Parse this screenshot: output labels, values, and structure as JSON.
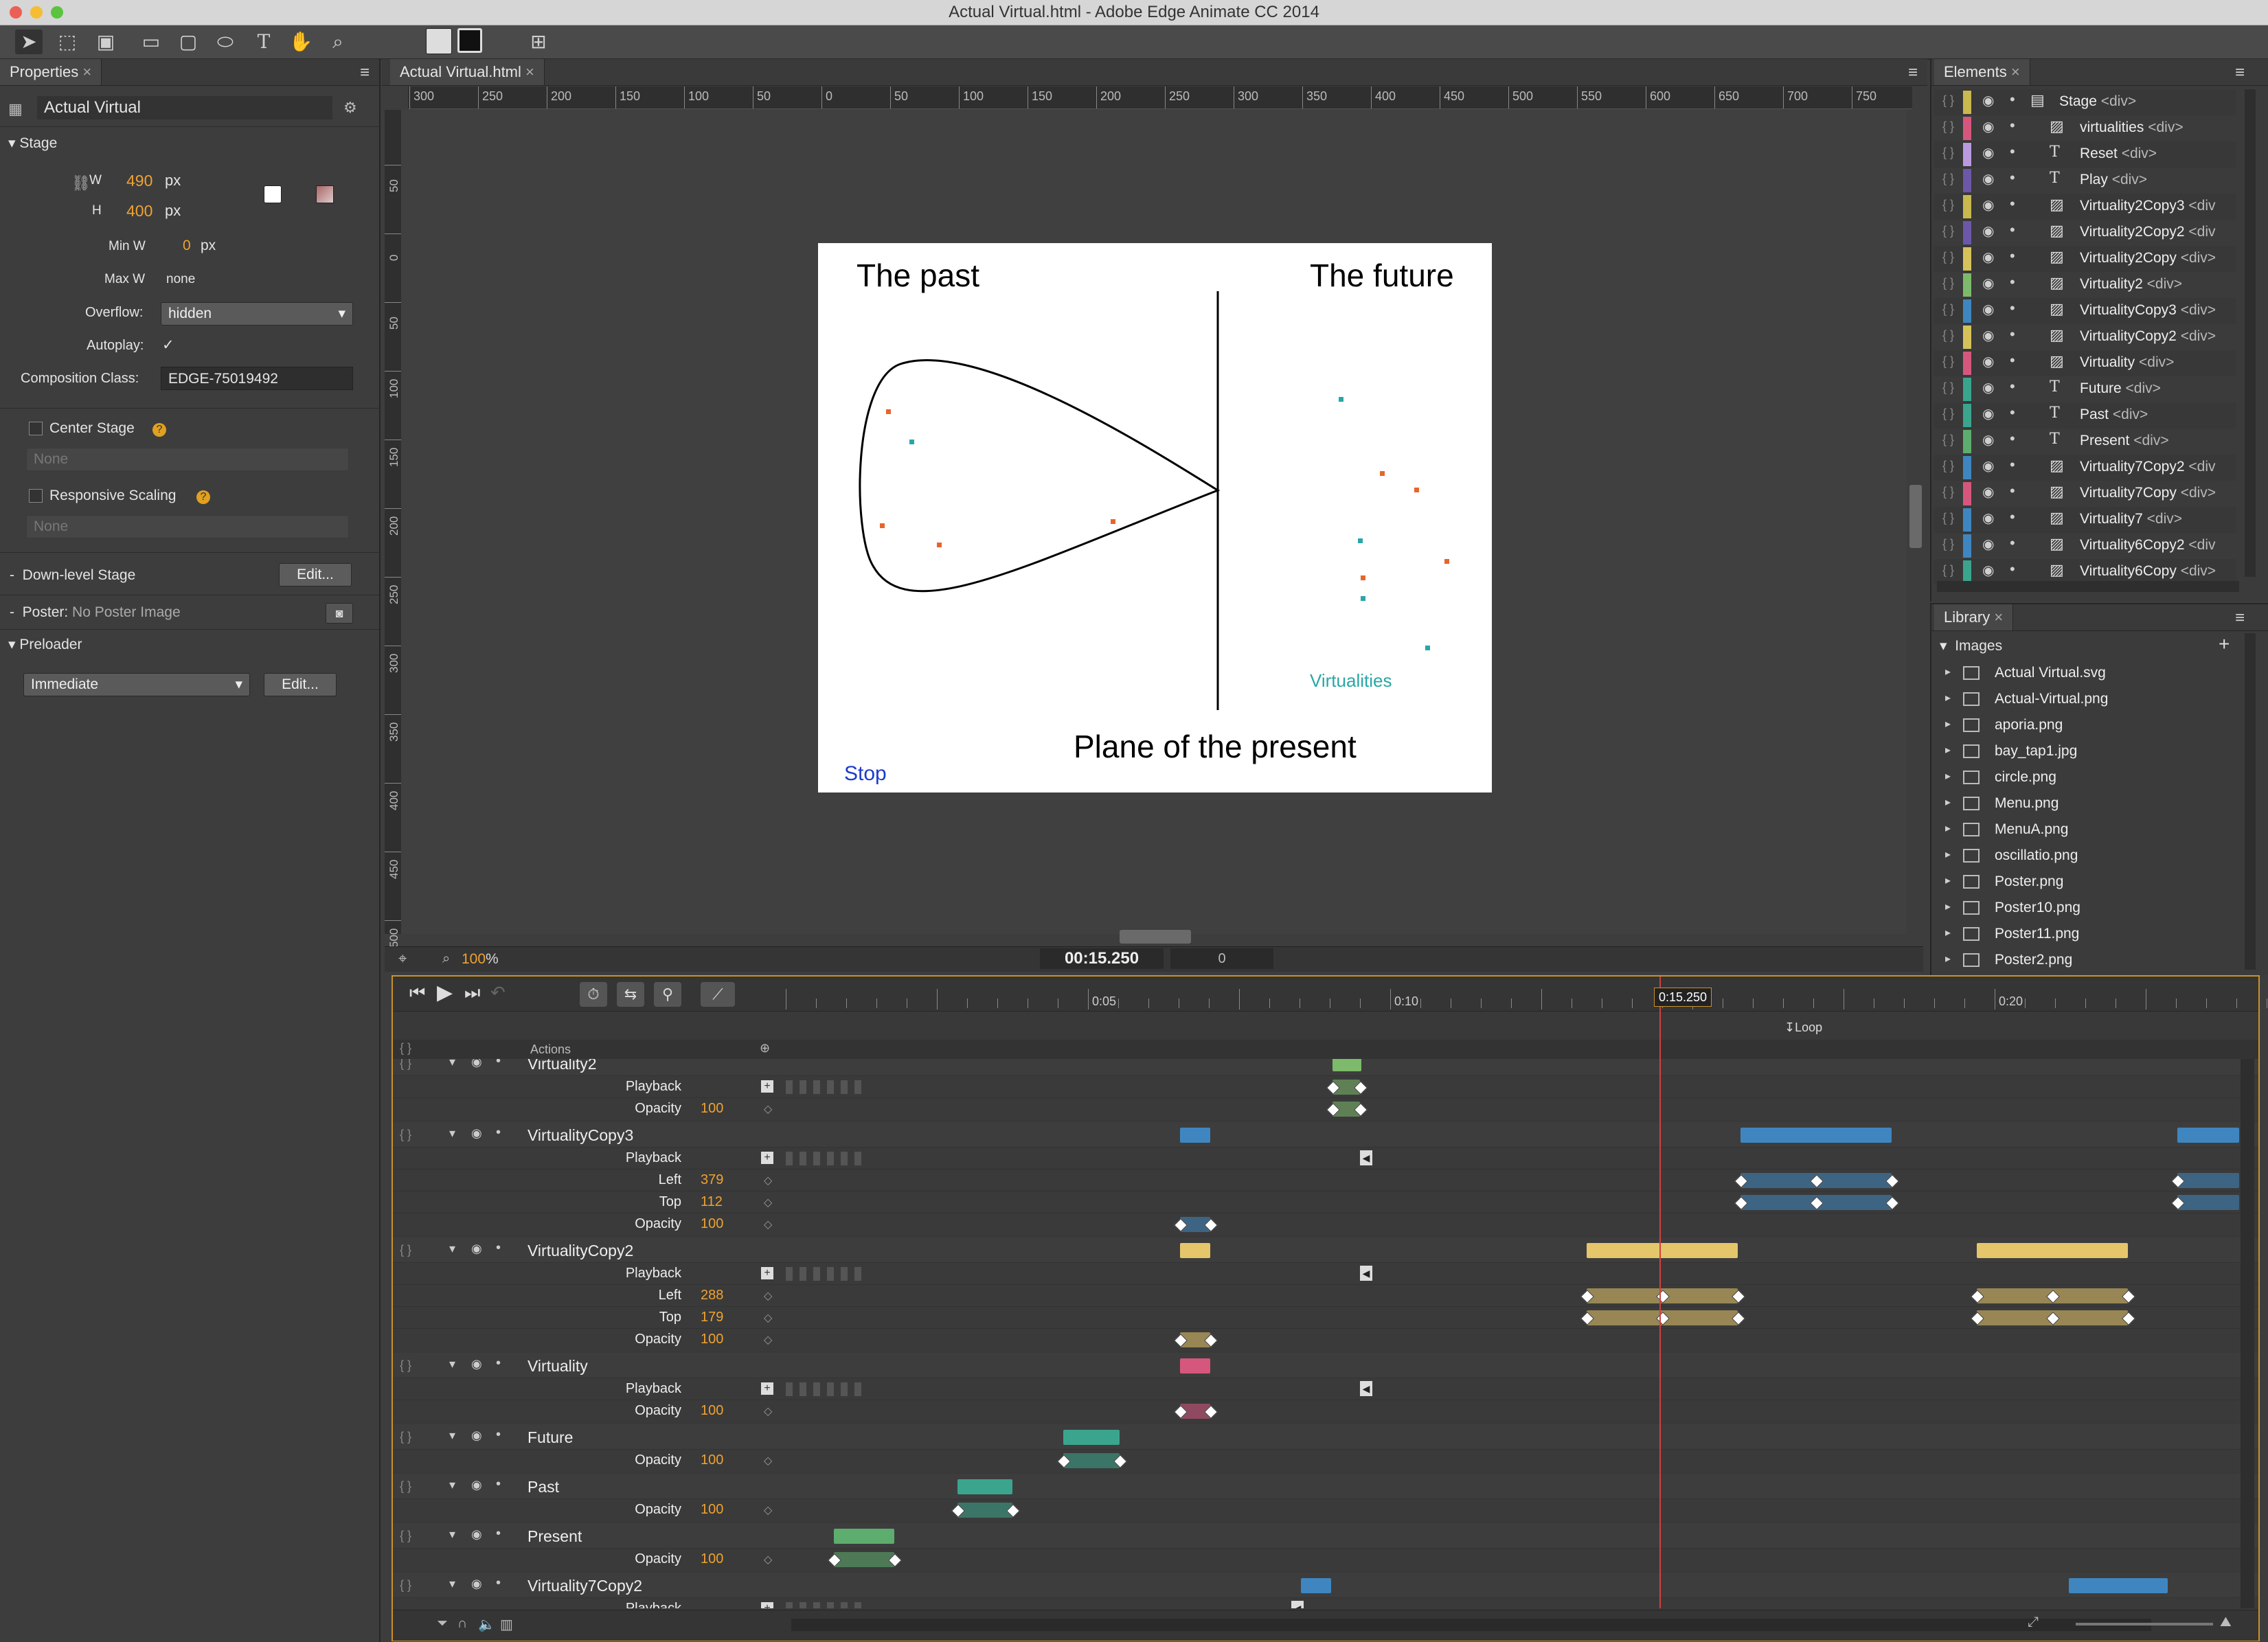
{
  "window": {
    "title": "Actual Virtual.html - Adobe Edge Animate CC 2014"
  },
  "properties": {
    "tab": "Properties",
    "element_name": "Actual Virtual",
    "stage_section": "Stage",
    "w_label": "W",
    "w_value": "490",
    "h_label": "H",
    "h_value": "400",
    "px": "px",
    "minw_label": "Min W",
    "minw_value": "0",
    "maxw_label": "Max W",
    "maxw_value": "none",
    "overflow_label": "Overflow:",
    "overflow_value": "hidden",
    "autoplay_label": "Autoplay:",
    "autoplay_check": "✓",
    "compclass_label": "Composition Class:",
    "compclass_value": "EDGE-75019492",
    "center_stage": "Center Stage",
    "center_none": "None",
    "responsive": "Responsive Scaling",
    "responsive_none": "None",
    "downlevel": "Down-level Stage",
    "edit": "Edit...",
    "poster_label": "Poster:",
    "poster_value": "No Poster Image",
    "preloader": "Preloader",
    "preloader_value": "Immediate"
  },
  "document": {
    "tab": "Actual Virtual.html",
    "ruler_h": [
      "300",
      "250",
      "200",
      "150",
      "100",
      "50",
      "0",
      "50",
      "100",
      "150",
      "200",
      "250",
      "300",
      "350",
      "400",
      "450",
      "500",
      "550",
      "600",
      "650",
      "700",
      "750"
    ],
    "ruler_v": [
      "50",
      "0",
      "50",
      "100",
      "150",
      "200",
      "250",
      "300",
      "350",
      "400",
      "450",
      "500"
    ],
    "zoom": "100",
    "zoom_unit": "%",
    "time": "00:15.250",
    "frame": "0"
  },
  "stage": {
    "past": "The past",
    "future": "The future",
    "plane": "Plane of the present",
    "virtualities": "Virtualities",
    "stop": "Stop",
    "accent_orange": "#e8652a",
    "accent_teal": "#2aa6a6",
    "stop_color": "#1c3bcc"
  },
  "elements": {
    "tab": "Elements",
    "rows": [
      {
        "icon": "folder",
        "name": "Stage",
        "tag": "<div>",
        "color": "#c9b94e"
      },
      {
        "icon": "img",
        "name": "virtualities",
        "tag": "<div>",
        "color": "#d6577d"
      },
      {
        "icon": "T",
        "name": "Reset",
        "tag": "<div>",
        "color": "#b99add"
      },
      {
        "icon": "T",
        "name": "Play",
        "tag": "<div>",
        "color": "#6b58a8"
      },
      {
        "icon": "img",
        "name": "Virtuality2Copy3",
        "tag": "<div",
        "color": "#c9b94e"
      },
      {
        "icon": "img",
        "name": "Virtuality2Copy2",
        "tag": "<div",
        "color": "#6b58a8"
      },
      {
        "icon": "img",
        "name": "Virtuality2Copy",
        "tag": "<div>",
        "color": "#d6c25a"
      },
      {
        "icon": "img",
        "name": "Virtuality2",
        "tag": "<div>",
        "color": "#7dba6b"
      },
      {
        "icon": "img",
        "name": "VirtualityCopy3",
        "tag": "<div>",
        "color": "#3f86c0"
      },
      {
        "icon": "img",
        "name": "VirtualityCopy2",
        "tag": "<div>",
        "color": "#d6c25a"
      },
      {
        "icon": "img",
        "name": "Virtuality",
        "tag": "<div>",
        "color": "#d6577d"
      },
      {
        "icon": "T",
        "name": "Future",
        "tag": "<div>",
        "color": "#3aa58c"
      },
      {
        "icon": "T",
        "name": "Past",
        "tag": "<div>",
        "color": "#3aa58c"
      },
      {
        "icon": "T",
        "name": "Present",
        "tag": "<div>",
        "color": "#5dad6e"
      },
      {
        "icon": "img",
        "name": "Virtuality7Copy2",
        "tag": "<div",
        "color": "#3f86c0"
      },
      {
        "icon": "img",
        "name": "Virtuality7Copy",
        "tag": "<div>",
        "color": "#d6577d"
      },
      {
        "icon": "img",
        "name": "Virtuality7",
        "tag": "<div>",
        "color": "#3f86c0"
      },
      {
        "icon": "img",
        "name": "Virtuality6Copy2",
        "tag": "<div",
        "color": "#3f86c0"
      },
      {
        "icon": "img",
        "name": "Virtuality6Copy",
        "tag": "<div>",
        "color": "#3aa58c"
      }
    ]
  },
  "library": {
    "tab": "Library",
    "section": "Images",
    "items": [
      "Actual Virtual.svg",
      "Actual-Virtual.png",
      "aporia.png",
      "bay_tap1.jpg",
      "circle.png",
      "Menu.png",
      "MenuA.png",
      "oscillatio.png",
      "Poster.png",
      "Poster10.png",
      "Poster11.png",
      "Poster2.png"
    ]
  },
  "timeline": {
    "ticks": [
      "0:05",
      "0:10",
      "0:15",
      "0:20"
    ],
    "playhead": "0:15.250",
    "loop": "Loop",
    "actions": "Actions",
    "tracks": [
      {
        "name": "Virtuality2",
        "color": "#7dba6b",
        "props": [
          {
            "label": "Playback"
          },
          {
            "label": "Opacity",
            "value": "100"
          }
        ]
      },
      {
        "name": "VirtualityCopy3",
        "color": "#3f86c0",
        "props": [
          {
            "label": "Playback"
          },
          {
            "label": "Left",
            "value": "379"
          },
          {
            "label": "Top",
            "value": "112"
          },
          {
            "label": "Opacity",
            "value": "100"
          }
        ]
      },
      {
        "name": "VirtualityCopy2",
        "color": "#e6c66a",
        "props": [
          {
            "label": "Playback"
          },
          {
            "label": "Left",
            "value": "288"
          },
          {
            "label": "Top",
            "value": "179"
          },
          {
            "label": "Opacity",
            "value": "100"
          }
        ]
      },
      {
        "name": "Virtuality",
        "color": "#d6577d",
        "props": [
          {
            "label": "Playback"
          },
          {
            "label": "Opacity",
            "value": "100"
          }
        ]
      },
      {
        "name": "Future",
        "color": "#3aa58c",
        "props": [
          {
            "label": "Opacity",
            "value": "100"
          }
        ]
      },
      {
        "name": "Past",
        "color": "#3aa58c",
        "props": [
          {
            "label": "Opacity",
            "value": "100"
          }
        ]
      },
      {
        "name": "Present",
        "color": "#5dad6e",
        "props": [
          {
            "label": "Opacity",
            "value": "100"
          }
        ]
      },
      {
        "name": "Virtuality7Copy2",
        "color": "#3f86c0",
        "props": [
          {
            "label": "Playback"
          }
        ]
      }
    ]
  }
}
